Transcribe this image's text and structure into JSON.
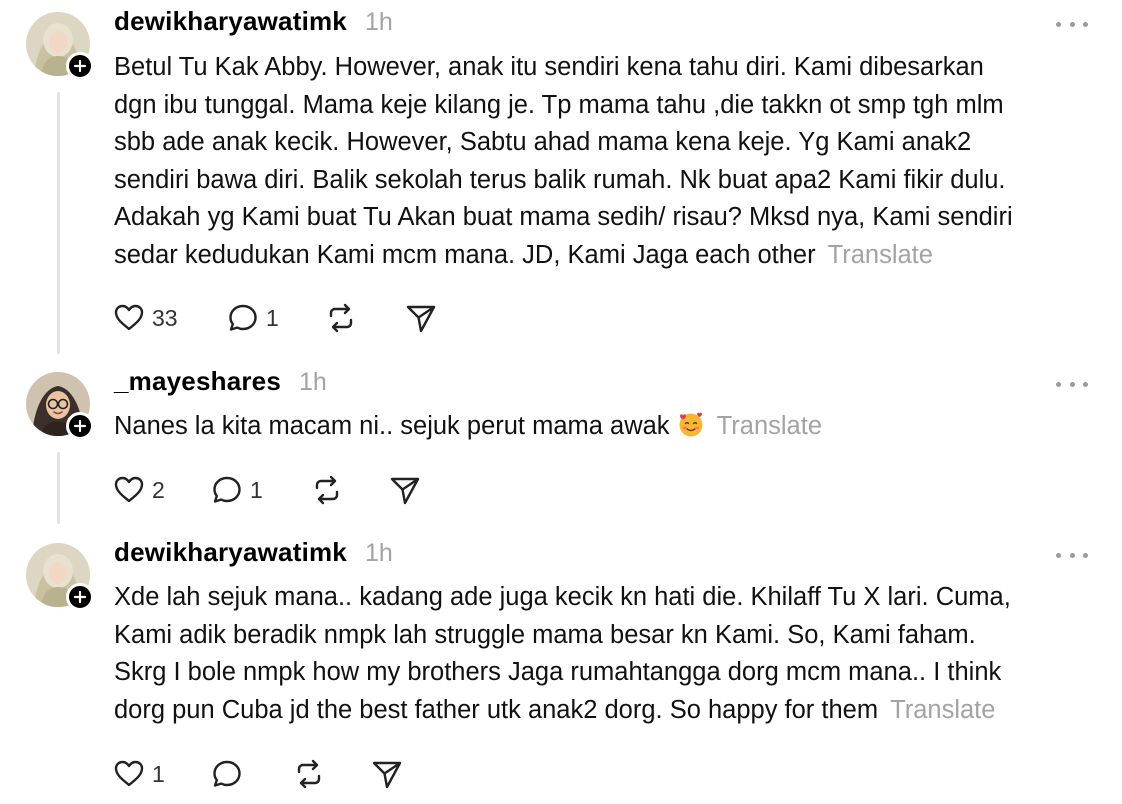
{
  "posts": [
    {
      "username": "dewikharyawatimk",
      "time": "1h",
      "text_lines": [
        "Betul Tu Kak Abby. However, anak itu sendiri kena tahu diri. Kami dibesarkan",
        "dgn ibu tunggal. Mama keje kilang je. Tp mama tahu ,die takkn ot smp tgh mlm",
        "sbb ade anak kecik. However, Sabtu ahad mama kena keje. Yg Kami anak2",
        "sendiri bawa diri. Balik sekolah terus balik rumah. Nk buat apa2 Kami fikir dulu.",
        "Adakah yg Kami buat Tu Akan buat mama sedih/ risau? Mksd nya, Kami sendiri",
        "sedar kedudukan Kami mcm mana. JD, Kami Jaga each other"
      ],
      "translate": "Translate",
      "likes": "33",
      "replies": "1",
      "avatar": "hijab-woman-avatar"
    },
    {
      "username": "_mayeshares",
      "time": "1h",
      "text_lines": [
        "Nanes la kita macam ni.. sejuk perut mama awak"
      ],
      "emoji": "smiling-face-with-hearts",
      "translate": "Translate",
      "likes": "2",
      "replies": "1",
      "avatar": "cartoon-hijab-glasses-avatar"
    },
    {
      "username": "dewikharyawatimk",
      "time": "1h",
      "text_lines": [
        "Xde lah sejuk mana.. kadang ade juga kecik kn hati die. Khilaff Tu X lari. Cuma,",
        "Kami adik beradik nmpk lah struggle mama besar kn Kami. So, Kami faham.",
        "Skrg I bole nmpk how my brothers Jaga rumahtangga dorg mcm mana.. I think",
        "dorg pun Cuba jd the best father utk anak2 dorg. So happy for them"
      ],
      "translate": "Translate",
      "likes": "1",
      "replies": "",
      "avatar": "hijab-woman-avatar"
    }
  ],
  "colors": {
    "secondary_text": "#a3a3a3",
    "thread_line": "#e3e3e3",
    "primary_text": "#111111"
  },
  "icons": [
    "heart-icon",
    "reply-icon",
    "repost-icon",
    "share-icon",
    "more-icon",
    "follow-plus-icon"
  ]
}
